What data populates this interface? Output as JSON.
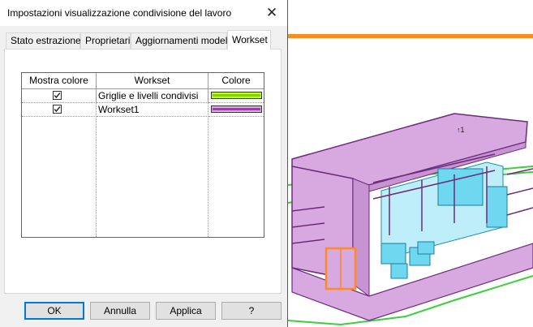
{
  "dialog": {
    "title": "Impostazioni visualizzazione condivisione del lavoro",
    "close_glyph": "✕",
    "tabs": [
      {
        "label": "Stato estrazione",
        "active": false
      },
      {
        "label": "Proprietari",
        "active": false
      },
      {
        "label": "Aggiornamenti modello",
        "active": false
      },
      {
        "label": "Workset",
        "active": true
      }
    ],
    "grid": {
      "headers": [
        "Mostra colore",
        "Workset",
        "Colore"
      ],
      "rows": [
        {
          "checked": true,
          "workset": "Griglie e livelli condivisi",
          "color": "#b5ff2e",
          "line": "#8fcc00"
        },
        {
          "checked": true,
          "workset": "Workset1",
          "color": "#e0a8e8",
          "line": "#a23ab2"
        }
      ]
    },
    "buttons": {
      "ok": "OK",
      "cancel": "Annulla",
      "apply": "Applica",
      "help": "?"
    }
  },
  "viewport": {
    "accent_color": "#ff8c1a",
    "model_color": "#d8a8e0",
    "model_edge": "#6a2c7a",
    "interior_color": "#6fd8f0",
    "ground_color": "#3ad03a"
  }
}
